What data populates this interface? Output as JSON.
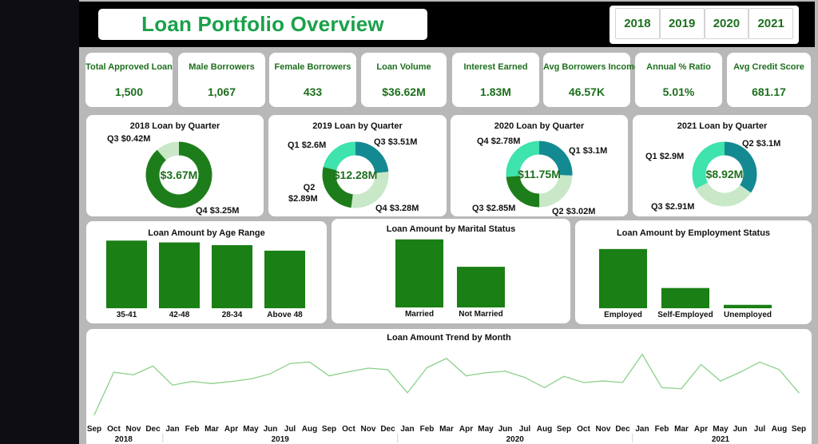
{
  "header": {
    "title": "Loan Portfolio Overview",
    "years": [
      "2018",
      "2019",
      "2020",
      "2021"
    ]
  },
  "kpis": [
    {
      "label": "Total Approved Loan",
      "value": "1,500"
    },
    {
      "label": "Male Borrowers",
      "value": "1,067"
    },
    {
      "label": "Female Borrowers",
      "value": "433"
    },
    {
      "label": "Loan Volume",
      "value": "$36.62M"
    },
    {
      "label": "Interest Earned",
      "value": "1.83M"
    },
    {
      "label": "Avg Borrowers Income",
      "value": "46.57K"
    },
    {
      "label": "Annual % Ratio",
      "value": "5.01%"
    },
    {
      "label": "Avg Credit Score",
      "value": "681.17"
    }
  ],
  "colors": {
    "dark_green": "#1e7d1b",
    "bar_green": "#1a7f14",
    "teal": "#138a92",
    "mint": "#3ee3ad",
    "pale_green": "#c8e8c8",
    "line": "#8ad18a"
  },
  "chart_data": [
    {
      "type": "pie",
      "title": "2018 Loan by Quarter",
      "center_label": "$3.67M",
      "slices": [
        {
          "name": "Q3",
          "value": 0.42,
          "label": "Q3 $0.42M",
          "color": "#c8e8c8"
        },
        {
          "name": "Q4",
          "value": 3.25,
          "label": "Q4 $3.25M",
          "color": "#1e7d1b"
        }
      ]
    },
    {
      "type": "pie",
      "title": "2019 Loan by Quarter",
      "center_label": "$12.28M",
      "slices": [
        {
          "name": "Q1",
          "value": 2.6,
          "label": "Q1 $2.6M",
          "color": "#3ee3ad"
        },
        {
          "name": "Q2",
          "value": 2.89,
          "label": "Q2 $2.89M",
          "color": "#138a92"
        },
        {
          "name": "Q3",
          "value": 3.51,
          "label": "Q3 $3.51M",
          "color": "#c8e8c8"
        },
        {
          "name": "Q4",
          "value": 3.28,
          "label": "Q4 $3.28M",
          "color": "#1e7d1b"
        }
      ]
    },
    {
      "type": "pie",
      "title": "2020 Loan by Quarter",
      "center_label": "$11.75M",
      "slices": [
        {
          "name": "Q1",
          "value": 3.1,
          "label": "Q1 $3.1M",
          "color": "#3ee3ad"
        },
        {
          "name": "Q2",
          "value": 3.02,
          "label": "Q2 $3.02M",
          "color": "#138a92"
        },
        {
          "name": "Q3",
          "value": 2.85,
          "label": "Q3 $2.85M",
          "color": "#c8e8c8"
        },
        {
          "name": "Q4",
          "value": 2.78,
          "label": "Q4 $2.78M",
          "color": "#1e7d1b"
        }
      ]
    },
    {
      "type": "pie",
      "title": "2021 Loan by Quarter",
      "center_label": "$8.92M",
      "slices": [
        {
          "name": "Q1",
          "value": 2.9,
          "label": "Q1 $2.9M",
          "color": "#3ee3ad"
        },
        {
          "name": "Q2",
          "value": 3.1,
          "label": "Q2 $3.1M",
          "color": "#138a92"
        },
        {
          "name": "Q3",
          "value": 2.91,
          "label": "Q3 $2.91M",
          "color": "#c8e8c8"
        }
      ]
    },
    {
      "type": "bar",
      "title": "Loan Amount by Age Range",
      "categories": [
        "35-41",
        "42-48",
        "28-34",
        "Above 48"
      ],
      "values": [
        7.4,
        7.2,
        6.9,
        6.3
      ],
      "ylim": [
        0,
        7.6
      ]
    },
    {
      "type": "bar",
      "title": "Loan Amount by Marital Status",
      "categories": [
        "Married",
        "Not Married"
      ],
      "values": [
        21.6,
        12.9
      ],
      "ylim": [
        0,
        22.3
      ]
    },
    {
      "type": "bar",
      "title": "Loan Amount by Employment Status",
      "categories": [
        "Employed",
        "Self-Employed",
        "Unemployed"
      ],
      "values": [
        24.3,
        8.3,
        1.4
      ],
      "ylim": [
        0,
        24.9
      ]
    },
    {
      "type": "line",
      "title": "Loan Amount Trend by Month",
      "x": [
        "Sep",
        "Oct",
        "Nov",
        "Dec",
        "Jan",
        "Feb",
        "Mar",
        "Apr",
        "May",
        "Jun",
        "Jul",
        "Aug",
        "Sep",
        "Oct",
        "Nov",
        "Dec",
        "Jan",
        "Feb",
        "Mar",
        "Apr",
        "May",
        "Jun",
        "Jul",
        "Aug",
        "Sep",
        "Oct",
        "Nov",
        "Dec",
        "Jan",
        "Feb",
        "Mar",
        "Apr",
        "May",
        "Jun",
        "Jul",
        "Aug",
        "Sep"
      ],
      "years": [
        {
          "label": "2018",
          "start": 0,
          "end": 3
        },
        {
          "label": "2019",
          "start": 4,
          "end": 15
        },
        {
          "label": "2020",
          "start": 16,
          "end": 27
        },
        {
          "label": "2021",
          "start": 28,
          "end": 36
        }
      ],
      "values": [
        0.42,
        1.25,
        1.2,
        1.37,
        1.0,
        1.07,
        1.03,
        1.07,
        1.12,
        1.22,
        1.42,
        1.45,
        1.18,
        1.26,
        1.33,
        1.3,
        0.85,
        1.34,
        1.52,
        1.18,
        1.24,
        1.27,
        1.15,
        0.95,
        1.17,
        1.05,
        1.08,
        1.05,
        1.6,
        0.95,
        0.93,
        1.4,
        1.08,
        1.25,
        1.45,
        1.3,
        0.85
      ],
      "ylim": [
        0.35,
        1.75
      ]
    }
  ]
}
